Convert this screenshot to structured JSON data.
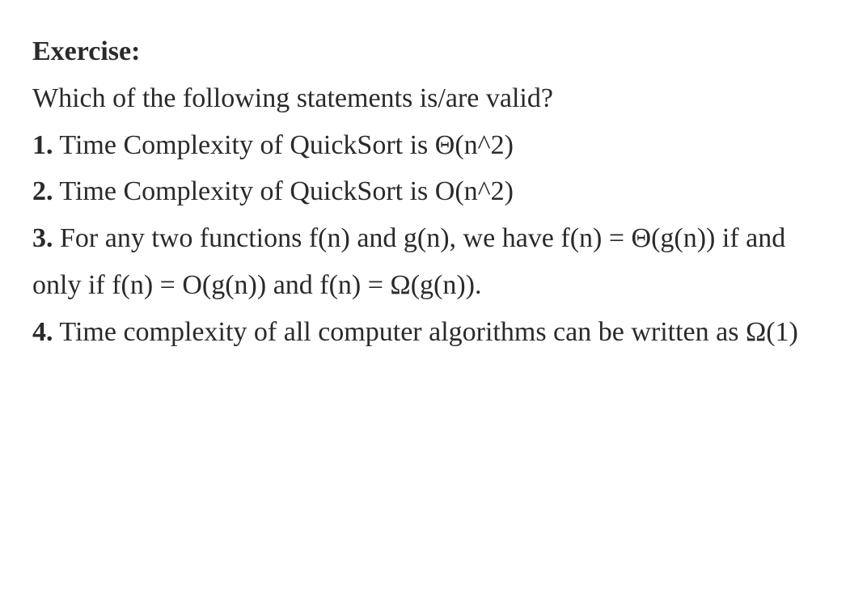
{
  "exercise": {
    "heading": "Exercise:",
    "question": "Which of the following statements is/are valid?",
    "items": [
      {
        "num": "1.",
        "text": "Time Complexity of QuickSort is Θ(n^2)"
      },
      {
        "num": "2.",
        "text": "Time Complexity of QuickSort is O(n^2)"
      },
      {
        "num": "3.",
        "text": "For any two functions f(n) and g(n), we have f(n) = Θ(g(n)) if and only if f(n) = O(g(n)) and f(n) = Ω(g(n))."
      },
      {
        "num": "4.",
        "text": "Time complexity of all computer algorithms can be written as Ω(1)"
      }
    ]
  }
}
